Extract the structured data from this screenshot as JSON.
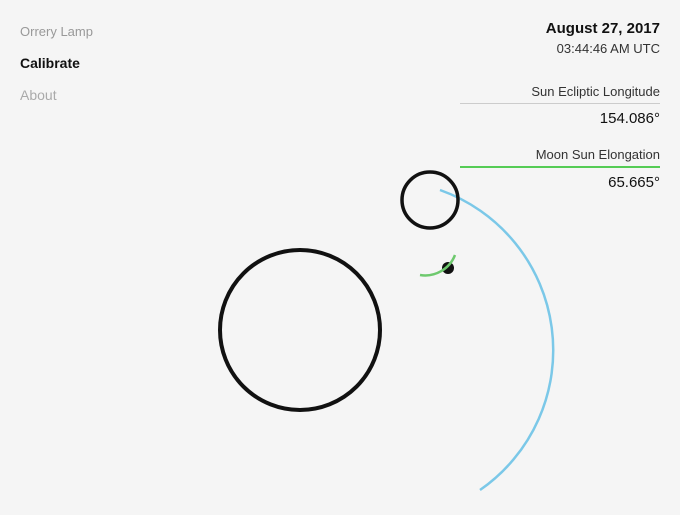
{
  "app": {
    "title": "Orrery Lamp"
  },
  "nav": {
    "calibrate_label": "Calibrate",
    "about_label": "About"
  },
  "info": {
    "date": "August 27, 2017",
    "time": "03:44:46 AM UTC",
    "sun_ecliptic_label": "Sun Ecliptic Longitude",
    "sun_ecliptic_value": "154.086°",
    "moon_elongation_label": "Moon Sun Elongation",
    "moon_elongation_value": "65.665°"
  },
  "colors": {
    "earth_stroke": "#111",
    "moon_stroke": "#111",
    "arc_blue": "#7bc8e8",
    "arc_green": "#6ec96e",
    "background": "#f5f5f5"
  }
}
